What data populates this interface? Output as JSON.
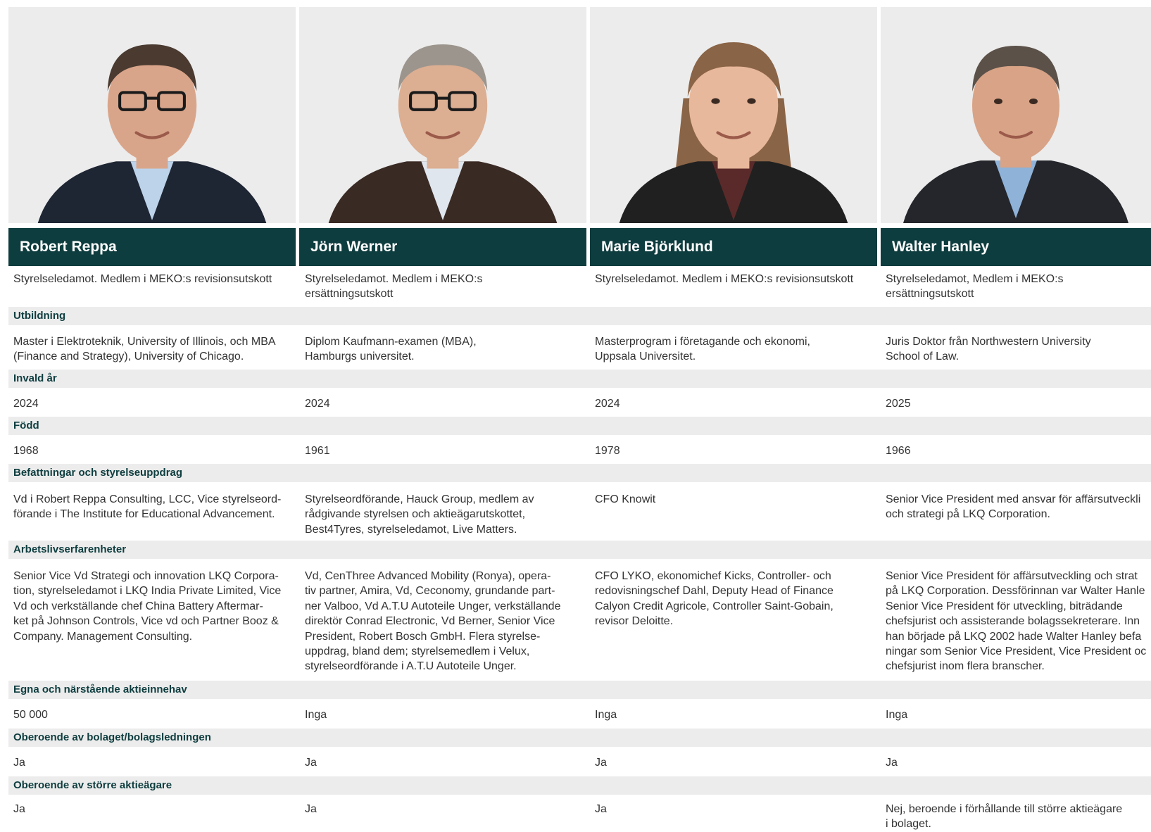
{
  "members": [
    {
      "name": "Robert Reppa",
      "role": [
        "Styrelseledamot. Medlem i MEKO:s revisionsutskott"
      ],
      "education": [
        "Master i Elektroteknik, University of Illinois, och MBA",
        "(Finance and Strategy), University of Chicago."
      ],
      "elected": "2024",
      "born": "1968",
      "positions": [
        "Vd i Robert Reppa Consulting, LCC, Vice styrelseord-",
        "förande i The Institute for Educational Advancement."
      ],
      "experience": [
        "Senior Vice Vd Strategi och innovation LKQ Corpora-",
        "tion, styrelseledamot i LKQ India Private Limited, Vice",
        "Vd och verkställande chef China Battery Aftermar-",
        "ket på Johnson Controls, Vice vd och Partner Booz &",
        "Company. Management Consulting."
      ],
      "holdings": "50 000",
      "independent_company": "Ja",
      "independent_shareholders": [
        "Ja"
      ]
    },
    {
      "name": "Jörn Werner",
      "role": [
        "Styrelseledamot. Medlem i MEKO:s",
        "ersättningsutskott"
      ],
      "education": [
        "Diplom Kaufmann-examen (MBA),",
        "Hamburgs universitet."
      ],
      "elected": "2024",
      "born": "1961",
      "positions": [
        "Styrelseordförande, Hauck Group, medlem av",
        "rådgivande styrelsen och aktieägarutskottet,",
        "Best4Tyres, styrelseledamot, Live Matters."
      ],
      "experience": [
        "Vd, CenThree Advanced Mobility (Ronya), opera-",
        "tiv partner, Amira, Vd, Ceconomy, grundande part-",
        "ner Valboo, Vd A.T.U Autoteile Unger, verkställande",
        "direktör Conrad Electronic, Vd Berner, Senior Vice",
        "President, Robert Bosch GmbH. Flera styrelse-",
        "uppdrag, bland dem; styrelsemedlem i Velux,",
        "styrelseordförande i A.T.U Autoteile Unger."
      ],
      "holdings": "Inga",
      "independent_company": "Ja",
      "independent_shareholders": [
        "Ja"
      ]
    },
    {
      "name": "Marie Björklund",
      "role": [
        "Styrelseledamot. Medlem i MEKO:s revisionsutskott"
      ],
      "education": [
        "Masterprogram i företagande och ekonomi,",
        "Uppsala Universitet."
      ],
      "elected": "2024",
      "born": "1978",
      "positions": [
        "CFO Knowit"
      ],
      "experience": [
        "CFO LYKO, ekonomichef Kicks, Controller- och",
        "redovisningschef Dahl, Deputy Head of Finance",
        "Calyon Credit Agricole, Controller Saint-Gobain,",
        "revisor Deloitte."
      ],
      "holdings": "Inga",
      "independent_company": "Ja",
      "independent_shareholders": [
        "Ja"
      ]
    },
    {
      "name": "Walter Hanley",
      "role": [
        "Styrelseledamot, Medlem i MEKO:s",
        "ersättningsutskott"
      ],
      "education": [
        "Juris Doktor från Northwestern University",
        "School of Law."
      ],
      "elected": "2025",
      "born": "1966",
      "positions": [
        "Senior Vice President med ansvar för affärsutveckli",
        "och strategi på LKQ Corporation."
      ],
      "experience": [
        "Senior Vice President för affärsutveckling och strat",
        "på LKQ Corporation. Dessförinnan var Walter Hanle",
        "Senior Vice President för utveckling, biträdande",
        "chefsjurist och assisterande bolagssekreterare. Inn",
        "han började på LKQ 2002 hade Walter Hanley befa",
        "ningar som Senior Vice President, Vice President oc",
        "chefsjurist inom flera branscher."
      ],
      "holdings": "Inga",
      "independent_company": "Ja",
      "independent_shareholders": [
        "Nej, beroende i förhållande till större aktieägare",
        "i bolaget."
      ]
    }
  ],
  "section_labels": {
    "education": "Utbildning",
    "elected": "Invald år",
    "born": "Född",
    "positions": "Befattningar och styrelseuppdrag",
    "experience": "Arbetslivserfarenheter",
    "holdings": "Egna och närstående aktieinnehav",
    "independent_company": "Oberoende av bolaget/bolagsledningen",
    "independent_shareholders": "Oberoende av större aktieägare"
  },
  "colors": {
    "header_bg": "#0e3d3f",
    "header_text": "#ffffff",
    "band_bg": "#ececec",
    "label_text": "#0e3d3f",
    "body_text": "#333333"
  }
}
